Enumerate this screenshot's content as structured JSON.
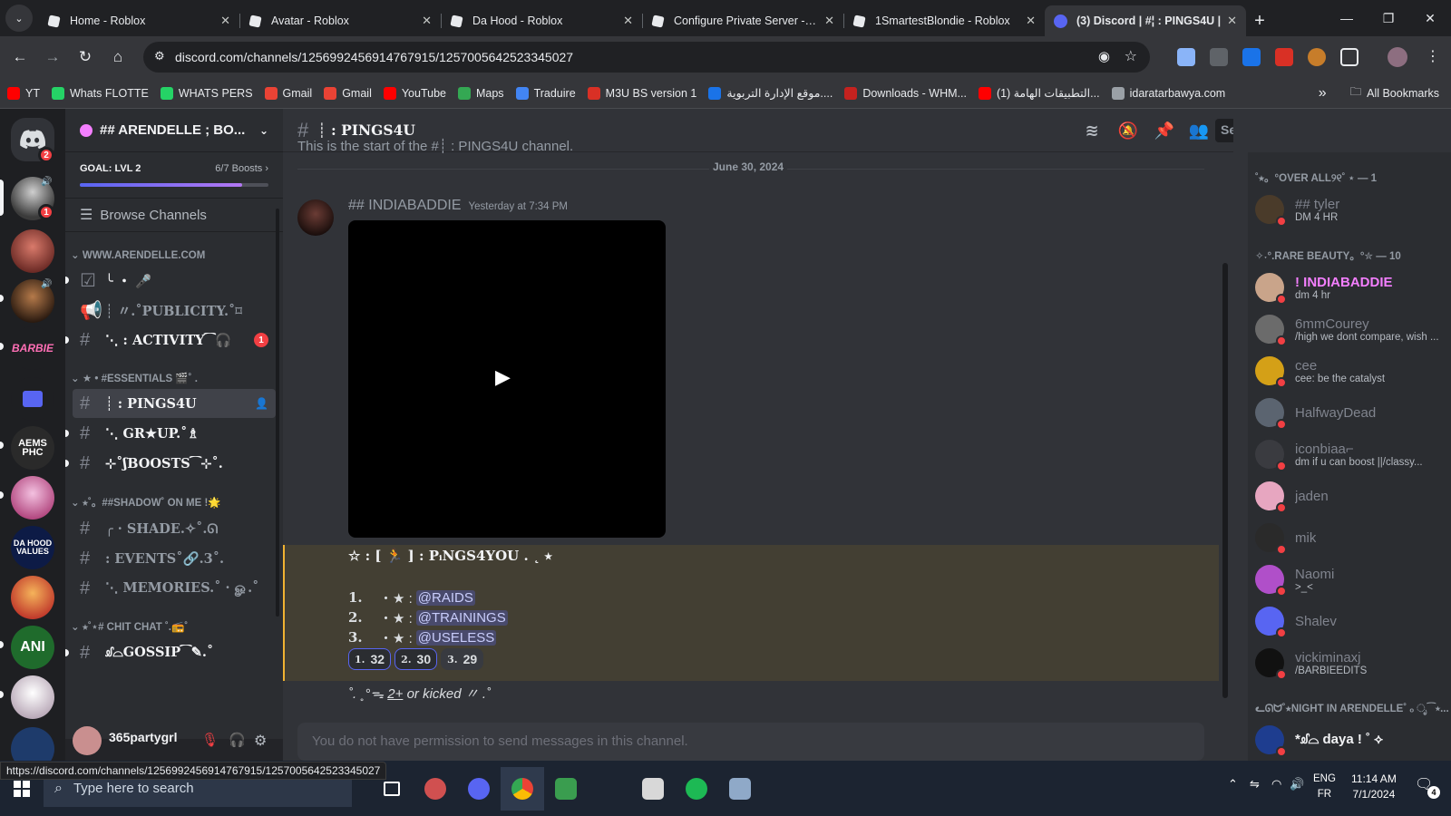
{
  "browser": {
    "tabs": [
      {
        "title": "Home - Roblox"
      },
      {
        "title": "Avatar - Roblox"
      },
      {
        "title": "Da Hood - Roblox"
      },
      {
        "title": "Configure Private Server - Ro"
      },
      {
        "title": "1SmartestBlondie - Roblox"
      },
      {
        "title": "(3) Discord | #¦ : PINGS4U |"
      }
    ],
    "url": "discord.com/channels/1256992456914767915/1257005642523345027",
    "status_url": "https://discord.com/channels/1256992456914767915/1257005642523345027",
    "bookmarks": [
      {
        "label": "YT",
        "color": "#ff0000"
      },
      {
        "label": "Whats FLOTTE",
        "color": "#25d366"
      },
      {
        "label": "WHATS  PERS",
        "color": "#25d366"
      },
      {
        "label": "Gmail",
        "color": "#ea4335"
      },
      {
        "label": "Gmail",
        "color": "#ea4335"
      },
      {
        "label": "YouTube",
        "color": "#ff0000"
      },
      {
        "label": "Maps",
        "color": "#34a853"
      },
      {
        "label": "Traduire",
        "color": "#4285f4"
      },
      {
        "label": "M3U BS version 1",
        "color": "#d93025"
      },
      {
        "label": "موقع الإدارة التربوية....",
        "color": "#1a73e8"
      },
      {
        "label": "Downloads - WHM...",
        "color": "#c5221f"
      },
      {
        "label": "(1) التطبيقات الهامة...",
        "color": "#ff0000"
      },
      {
        "label": "idaratarbawya.com",
        "color": "#9aa0a6"
      }
    ],
    "all_bookmarks": "All Bookmarks"
  },
  "server": {
    "name": "## ARENDELLE ; BO...",
    "goal": "GOAL: LVL 2",
    "boosts": "6/7 Boosts",
    "boost_progress": 0.86,
    "browse": "Browse Channels"
  },
  "channels": [
    {
      "type": "cat",
      "label": "WWW.ARENDELLE.COM"
    },
    {
      "type": "ch",
      "icon": "☑",
      "label": "╰ ・ 🎤",
      "unread": true
    },
    {
      "type": "ch",
      "icon": "📢",
      "label": "┊ 〃.˚PUBLICITY.˚⌑"
    },
    {
      "type": "ch",
      "icon": "#",
      "label": "⋱ : ACTIVITY⁀🎧",
      "badge": "1",
      "unread": true
    },
    {
      "type": "cat",
      "label": "★ • #ESSENTIALS 🎬˚ ."
    },
    {
      "type": "ch",
      "icon": "#",
      "label": "┊ : PINGS4U",
      "selected": true
    },
    {
      "type": "ch",
      "icon": "#",
      "label": "⋱ GR★UP.˚♗",
      "unread": true
    },
    {
      "type": "ch",
      "icon": "#",
      "label": "⊹˚ʃBOOSTS⁀⊹˚.",
      "unread": true
    },
    {
      "type": "cat",
      "label": "⭑˚。##SHADOW˚ ON ME !🌟"
    },
    {
      "type": "ch",
      "icon": "#",
      "label": "╭ · SHADE.✧˚.ᘏ"
    },
    {
      "type": "ch",
      "icon": "#",
      "label": ": EVENTS˚🔗.3˚."
    },
    {
      "type": "ch",
      "icon": "#",
      "label": "⋱ MEMORIES.˚ · ௐ.˚"
    },
    {
      "type": "cat",
      "label": "⭑˚⋆# CHIT CHAT ˚.📻˚"
    },
    {
      "type": "ch",
      "icon": "#",
      "label": "ᦾ⌓GOSSIP⁀✎.˚",
      "unread": true
    }
  ],
  "user_panel": {
    "name": "365partygrl"
  },
  "channel_header": {
    "name": "┊ : PINGS4U",
    "search": "Search"
  },
  "chat": {
    "start_fragment": "This is the start of the #┊ : PINGS4U channel.",
    "date_divider": "June 30, 2024",
    "author": "## INDIABADDIE",
    "timestamp": "Yesterday at 7:34 PM",
    "line1": "☆ : [ 🏃 ] : PᵢNGS4YOU . ˛ ⭑",
    "items": [
      {
        "num": "1.",
        "mention": "@RAIDS"
      },
      {
        "num": "2.",
        "mention": "@TRAININGS"
      },
      {
        "num": "3.",
        "mention": "@USELESS"
      }
    ],
    "item_prefix": "・★ :",
    "reactions": [
      {
        "emoji": "1.",
        "count": "32",
        "active": true
      },
      {
        "emoji": "2.",
        "count": "30",
        "active": true
      },
      {
        "emoji": "3.",
        "count": "29",
        "active": false
      }
    ],
    "footer_pre": "˚. ˳°ᯓ ",
    "footer_underline": "2+",
    "footer_post": " or kicked 〃 .˚",
    "no_permission": "You do not have permission to send messages in this channel."
  },
  "members": {
    "groups": [
      {
        "label": "˚⭑。°OVER ALL୨୧˚ ⋆ — 1",
        "members": [
          {
            "name": "## tyler",
            "status": "DM 4 HR",
            "color": "#80848e",
            "av": "#4a3b2a"
          }
        ]
      },
      {
        "label": "✧˖°.RARE BEAUTY。°✮ — 10",
        "members": [
          {
            "name": "! INDIABADDIE",
            "status": "dm 4 hr",
            "color": "#f47fff",
            "av": "#c9a48a"
          },
          {
            "name": "6mmCourey",
            "status": "/high we dont compare, wish ...",
            "color": "#80848e",
            "av": "#6b6b6b"
          },
          {
            "name": "cee",
            "status": "cee: be the catalyst",
            "color": "#80848e",
            "av": "#d4a017"
          },
          {
            "name": "HalfwayDead",
            "status": "",
            "color": "#80848e",
            "av": "#5b6470"
          },
          {
            "name": "iconbiaa⌐",
            "status": "dm if u can boost ||/classy...",
            "color": "#80848e",
            "av": "#3a3b40"
          },
          {
            "name": "jaden",
            "status": "",
            "color": "#80848e",
            "av": "#e7a6c0"
          },
          {
            "name": "mik",
            "status": "",
            "color": "#80848e",
            "av": "#2a2a2a"
          },
          {
            "name": "Naomi",
            "status": ">_<",
            "color": "#80848e",
            "av": "#b04fc9"
          },
          {
            "name": "Shalev",
            "status": "",
            "color": "#80848e",
            "av": "#5865f2"
          },
          {
            "name": "vickiminaxj",
            "status": "/BARBIEEDITS",
            "color": "#80848e",
            "av": "#111111"
          }
        ]
      },
      {
        "label": "ᓚᘏᗢ˚⭑NIGHT IN ARENDELLE˚ ₒ ೃ⁀⭑...",
        "members": [
          {
            "name": "*ᦾ⌓ daya ! ˚ ⟡",
            "status": "",
            "color": "#f2f3f5",
            "av": "#1e3d8f"
          },
          {
            "name": "365partygrl",
            "status": "",
            "color": "#f2f3f5",
            "av": "#c98f8f"
          }
        ]
      }
    ]
  },
  "taskbar": {
    "search_placeholder": "Type here to search",
    "lang1": "ENG",
    "lang2": "FR",
    "time": "11:14 AM",
    "date": "7/1/2024",
    "notif_count": "4"
  }
}
